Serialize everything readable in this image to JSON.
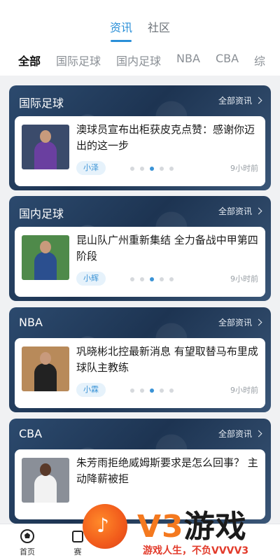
{
  "main_tabs": [
    {
      "label": "资讯",
      "active": true
    },
    {
      "label": "社区",
      "active": false
    }
  ],
  "sub_tabs": [
    {
      "label": "全部",
      "active": true
    },
    {
      "label": "国际足球",
      "active": false
    },
    {
      "label": "国内足球",
      "active": false
    },
    {
      "label": "NBA",
      "active": false
    },
    {
      "label": "CBA",
      "active": false
    },
    {
      "label": "综",
      "active": false
    }
  ],
  "sections": [
    {
      "title": "国际足球",
      "more_label": "全部资讯",
      "headline": "澳球员宣布出柜获皮克点赞：感谢你迈出的这一步",
      "author": "小泽",
      "time": "9小时前",
      "thumb_colors": {
        "bg": "#3b4b6b",
        "shirt": "#6a3fa0"
      }
    },
    {
      "title": "国内足球",
      "more_label": "全部资讯",
      "headline": "昆山队广州重新集结 全力备战中甲第四阶段",
      "author": "小辉",
      "time": "9小时前",
      "thumb_colors": {
        "bg": "#4f8a4a",
        "shirt": "#2b4f8f"
      }
    },
    {
      "title": "NBA",
      "more_label": "全部资讯",
      "headline": "巩晓彬北控最新消息 有望取替马布里成球队主教练",
      "author": "小霖",
      "time": "9小时前",
      "thumb_colors": {
        "bg": "#b88a5a",
        "shirt": "#222222"
      }
    },
    {
      "title": "CBA",
      "more_label": "全部资讯",
      "headline": "朱芳雨拒绝威姆斯要求是怎么回事？ 主动降薪被拒",
      "author": "",
      "time": "",
      "thumb_colors": {
        "bg": "#8a8f98",
        "shirt": "#f2f2f2"
      }
    }
  ],
  "carousel": {
    "count": 5,
    "active_index": 2
  },
  "bottom_nav": [
    {
      "label": "首页",
      "icon": "home-soccer-icon"
    },
    {
      "label": "赛",
      "icon": "schedule-icon"
    }
  ],
  "watermark": {
    "brand_v3": "V3",
    "brand_game": "游戏",
    "slogan": "游戏人生，不负VVVV3",
    "icon": "music-note-icon"
  },
  "colors": {
    "accent": "#2a8fd8",
    "section_bg": "#23395a",
    "watermark_orange": "#f4791f",
    "watermark_red": "#e23b2b"
  }
}
